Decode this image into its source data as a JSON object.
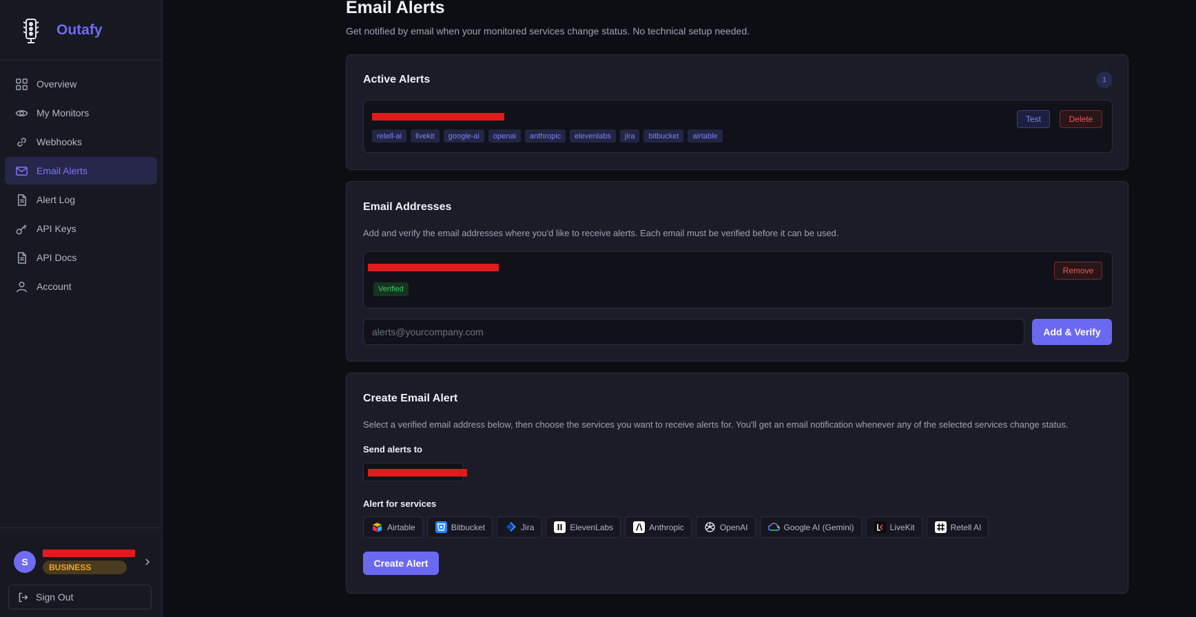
{
  "app": {
    "name": "Outafy",
    "logo_icon": "traffic-light-icon"
  },
  "sidebar": {
    "items": [
      {
        "label": "Overview",
        "icon": "grid-icon",
        "active": false
      },
      {
        "label": "My Monitors",
        "icon": "eye-icon",
        "active": false
      },
      {
        "label": "Webhooks",
        "icon": "link-icon",
        "active": false
      },
      {
        "label": "Email Alerts",
        "icon": "mail-icon",
        "active": true
      },
      {
        "label": "Alert Log",
        "icon": "document-icon",
        "active": false
      },
      {
        "label": "API Keys",
        "icon": "key-icon",
        "active": false
      },
      {
        "label": "API Docs",
        "icon": "document-icon",
        "active": false
      },
      {
        "label": "Account",
        "icon": "user-icon",
        "active": false
      }
    ],
    "user": {
      "initial": "S",
      "plan": "BUSINESS"
    },
    "sign_out": "Sign Out"
  },
  "page": {
    "title": "Email Alerts",
    "subtitle": "Get notified by email when your monitored services change status. No technical setup needed."
  },
  "active_alerts": {
    "title": "Active Alerts",
    "count": "1",
    "alert": {
      "tags": [
        "retell-ai",
        "livekit",
        "google-ai",
        "openai",
        "anthropic",
        "elevenlabs",
        "jira",
        "bitbucket",
        "airtable"
      ],
      "test_label": "Test",
      "delete_label": "Delete"
    }
  },
  "email_addresses": {
    "title": "Email Addresses",
    "description": "Add and verify the email addresses where you'd like to receive alerts. Each email must be verified before it can be used.",
    "entry": {
      "status": "Verified",
      "remove_label": "Remove"
    },
    "input_placeholder": "alerts@yourcompany.com",
    "add_label": "Add & Verify"
  },
  "create_alert": {
    "title": "Create Email Alert",
    "description": "Select a verified email address below, then choose the services you want to receive alerts for. You'll get an email notification whenever any of the selected services change status.",
    "send_to_label": "Send alerts to",
    "services_label": "Alert for services",
    "services": [
      {
        "label": "Airtable",
        "icon": "airtable-icon",
        "color": "#fcb400"
      },
      {
        "label": "Bitbucket",
        "icon": "bitbucket-icon",
        "color": "#2684ff"
      },
      {
        "label": "Jira",
        "icon": "jira-icon",
        "color": "#2684ff"
      },
      {
        "label": "ElevenLabs",
        "icon": "elevenlabs-icon",
        "color": "#ffffff"
      },
      {
        "label": "Anthropic",
        "icon": "anthropic-icon",
        "color": "#ffffff"
      },
      {
        "label": "OpenAI",
        "icon": "openai-icon",
        "color": "#ffffff"
      },
      {
        "label": "Google AI (Gemini)",
        "icon": "google-cloud-icon",
        "color": "#4285f4"
      },
      {
        "label": "LiveKit",
        "icon": "livekit-icon",
        "color": "#ff4d4d"
      },
      {
        "label": "Retell AI",
        "icon": "retell-icon",
        "color": "#ffffff"
      }
    ],
    "submit_label": "Create Alert"
  },
  "colors": {
    "accent": "#6b69f0",
    "danger": "#f05a5a",
    "success": "#41c46b",
    "plan": "#f5a524"
  }
}
